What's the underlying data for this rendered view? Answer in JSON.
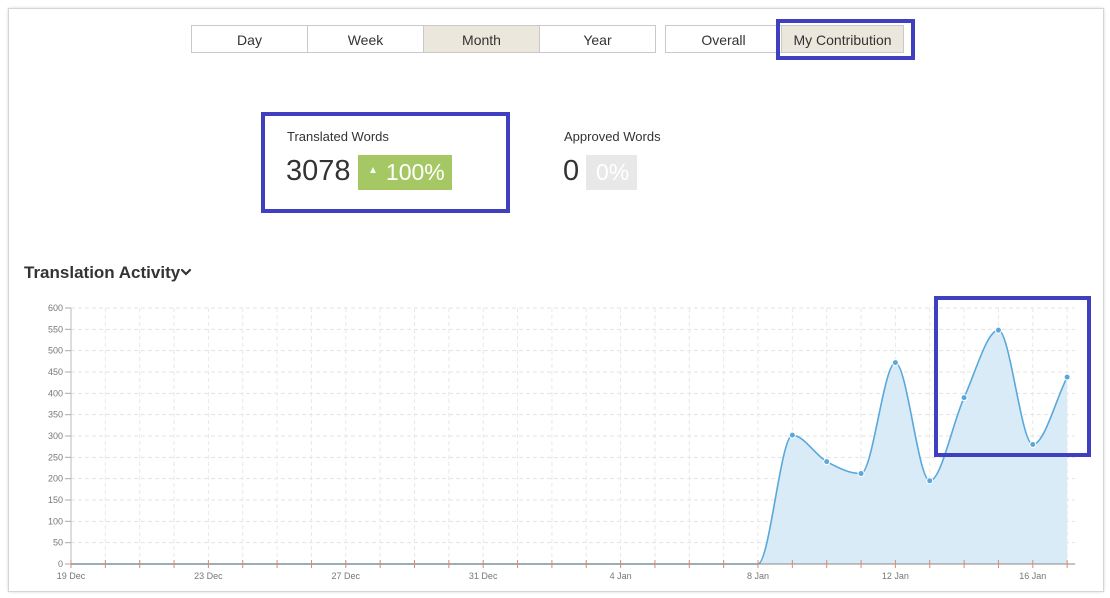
{
  "period_tabs": [
    {
      "label": "Day",
      "active": false
    },
    {
      "label": "Week",
      "active": false
    },
    {
      "label": "Month",
      "active": true
    },
    {
      "label": "Year",
      "active": false
    }
  ],
  "scope_tabs": [
    {
      "label": "Overall",
      "active": false
    },
    {
      "label": "My Contribution",
      "active": true
    }
  ],
  "stats": {
    "translated": {
      "label": "Translated Words",
      "value": "3078",
      "change": "100%"
    },
    "approved": {
      "label": "Approved Words",
      "value": "0",
      "change": "0%"
    }
  },
  "section": {
    "title": "Translation Activity"
  },
  "colors": {
    "accent_green": "#a5c864",
    "highlight": "#3f3fbf",
    "line": "#5aa8db",
    "area": "#d9ebf7"
  },
  "chart_data": {
    "type": "area",
    "x": [
      "19 Dec",
      "20 Dec",
      "21 Dec",
      "22 Dec",
      "23 Dec",
      "24 Dec",
      "25 Dec",
      "26 Dec",
      "27 Dec",
      "28 Dec",
      "29 Dec",
      "30 Dec",
      "31 Dec",
      "1 Jan",
      "2 Jan",
      "3 Jan",
      "4 Jan",
      "5 Jan",
      "6 Jan",
      "7 Jan",
      "8 Jan",
      "9 Jan",
      "10 Jan",
      "11 Jan",
      "12 Jan",
      "13 Jan",
      "14 Jan",
      "15 Jan",
      "16 Jan",
      "17 Jan"
    ],
    "tick_labels": [
      "19 Dec",
      "23 Dec",
      "27 Dec",
      "31 Dec",
      "4 Jan",
      "8 Jan",
      "12 Jan",
      "16 Jan"
    ],
    "series": [
      {
        "values": [
          0,
          0,
          0,
          0,
          0,
          0,
          0,
          0,
          0,
          0,
          0,
          0,
          0,
          0,
          0,
          0,
          0,
          0,
          0,
          0,
          0,
          302,
          240,
          212,
          472,
          195,
          390,
          548,
          280,
          438
        ]
      }
    ],
    "ylim": [
      0,
      600
    ],
    "yticks": [
      0,
      50,
      100,
      150,
      200,
      250,
      300,
      350,
      400,
      450,
      500,
      550,
      600
    ],
    "grid": true
  }
}
